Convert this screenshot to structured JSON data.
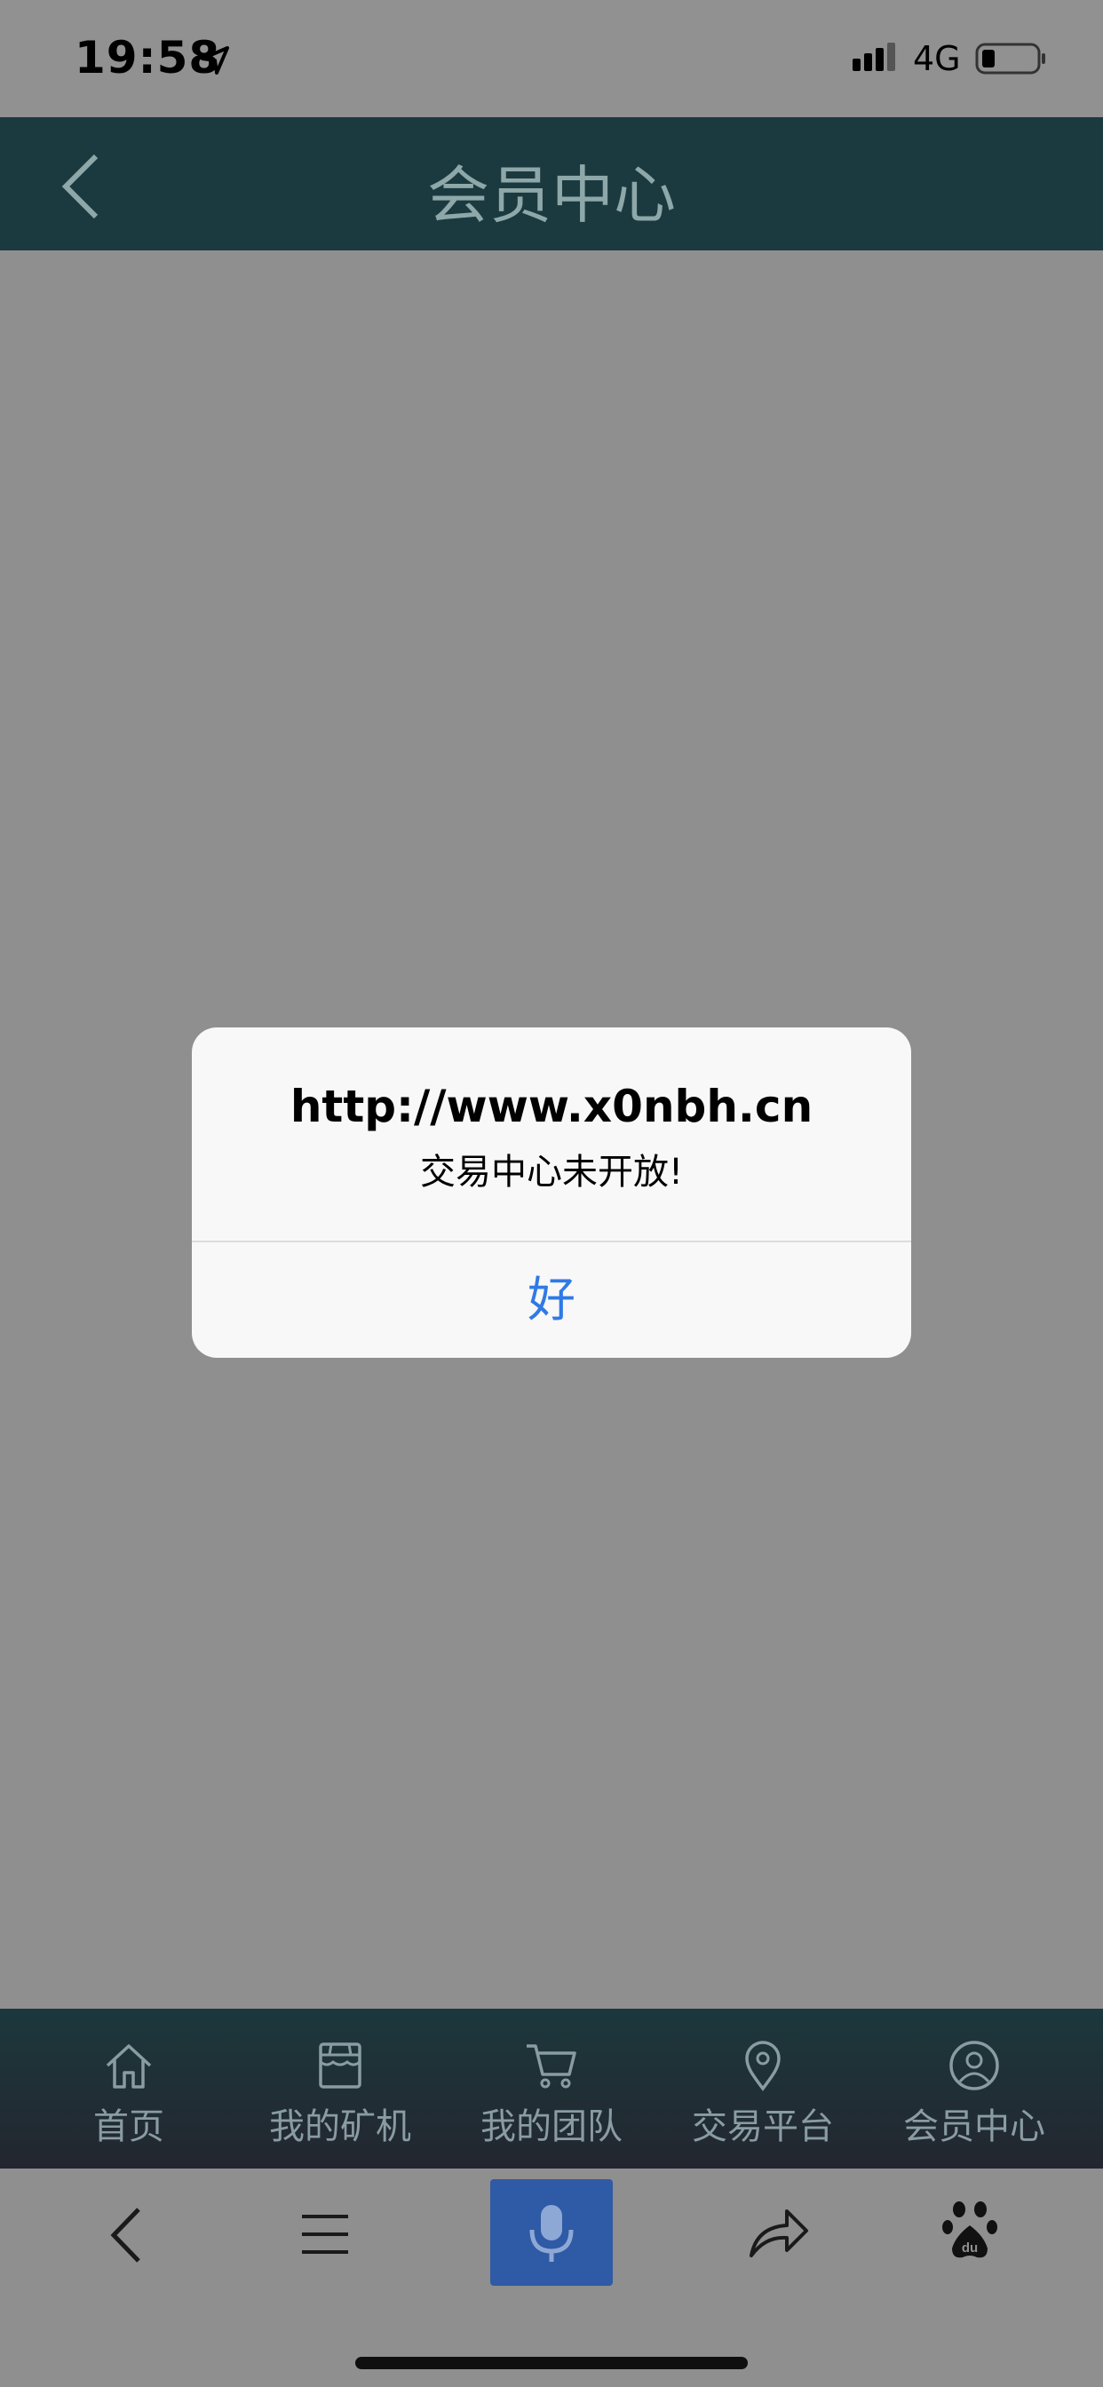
{
  "status_bar": {
    "time": "19:58",
    "network": "4G"
  },
  "nav": {
    "title": "会员中心"
  },
  "tabs": [
    {
      "label": "首页",
      "icon": "home-icon"
    },
    {
      "label": "我的矿机",
      "icon": "store-icon"
    },
    {
      "label": "我的团队",
      "icon": "cart-icon"
    },
    {
      "label": "交易平台",
      "icon": "location-pin-icon"
    },
    {
      "label": "会员中心",
      "icon": "user-icon"
    }
  ],
  "alert": {
    "title": "http://www.x0nbh.cn",
    "message": "交易中心未开放!",
    "ok_label": "好"
  },
  "browser_bar": {
    "buttons": [
      "back-icon",
      "menu-icon",
      "microphone-icon",
      "share-icon",
      "baidu-paw-icon"
    ]
  },
  "colors": {
    "nav_bg": "#1b3a40",
    "dim_overlay": "#8f8f8f",
    "alert_button": "#2f7ae5",
    "mic_button": "#2f5aa5"
  }
}
